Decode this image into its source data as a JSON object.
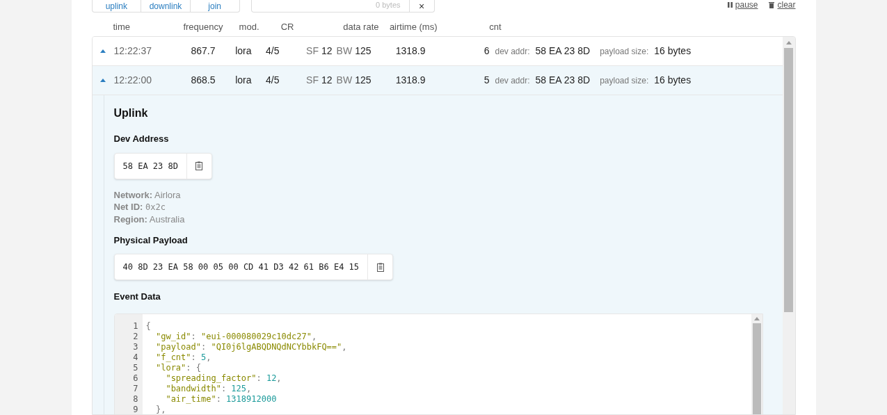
{
  "toolbar": {
    "filters": [
      {
        "label": "uplink"
      },
      {
        "label": "downlink"
      },
      {
        "label": "join"
      }
    ],
    "byte_counter": "0 bytes",
    "close": "×",
    "actions": [
      {
        "kind": "pause",
        "label": "pause"
      },
      {
        "kind": "clear",
        "label": "clear"
      }
    ]
  },
  "table": {
    "columns": [
      "time",
      "frequency",
      "mod.",
      "CR",
      "data rate",
      "airtime (ms)",
      "cnt"
    ],
    "rows": [
      {
        "selected": false,
        "time": "12:22:37",
        "frequency": "867.7",
        "modulation": "lora",
        "cr": "4/5",
        "data_rate": [
          {
            "label": "SF",
            "value": "12"
          },
          {
            "label": "BW",
            "value": "125"
          }
        ],
        "airtime": "1318.9",
        "cnt": "6",
        "details": [
          {
            "label": "dev addr:",
            "value": "58 EA 23 8D"
          },
          {
            "label": "payload size:",
            "value": "16 bytes"
          }
        ]
      },
      {
        "selected": true,
        "time": "12:22:00",
        "frequency": "868.5",
        "modulation": "lora",
        "cr": "4/5",
        "data_rate": [
          {
            "label": "SF",
            "value": "12"
          },
          {
            "label": "BW",
            "value": "125"
          }
        ],
        "airtime": "1318.9",
        "cnt": "5",
        "details": [
          {
            "label": "dev addr:",
            "value": "58 EA 23 8D"
          },
          {
            "label": "payload size:",
            "value": "16 bytes"
          }
        ]
      }
    ]
  },
  "detail": {
    "title": "Uplink",
    "dev_address": {
      "heading": "Dev Address",
      "value": "58 EA 23 8D"
    },
    "network_info": [
      {
        "label": "Network:",
        "value": "Airlora",
        "mono": false
      },
      {
        "label": "Net ID:",
        "value": "0x2c",
        "mono": true
      },
      {
        "label": "Region:",
        "value": "Australia",
        "mono": false
      }
    ],
    "physical_payload": {
      "heading": "Physical Payload",
      "value": "40 8D 23 EA 58 00 05 00 CD 41 D3 42 61 B6 E4 15"
    },
    "event_data": {
      "heading": "Event Data",
      "lines": [
        {
          "number": "1",
          "code": "{"
        },
        {
          "number": "2",
          "code": "  \"gw_id\": \"eui-000080029c10dc27\","
        },
        {
          "number": "3",
          "code": "  \"payload\": \"QI0j6lgABQDNQdNCYbbkFQ==\","
        },
        {
          "number": "4",
          "code": "  \"f_cnt\": 5,"
        },
        {
          "number": "5",
          "code": "  \"lora\": {"
        },
        {
          "number": "6",
          "code": "    \"spreading_factor\": 12,"
        },
        {
          "number": "7",
          "code": "    \"bandwidth\": 125,"
        },
        {
          "number": "8",
          "code": "    \"air_time\": 1318912000"
        },
        {
          "number": "9",
          "code": "  },"
        }
      ]
    }
  }
}
